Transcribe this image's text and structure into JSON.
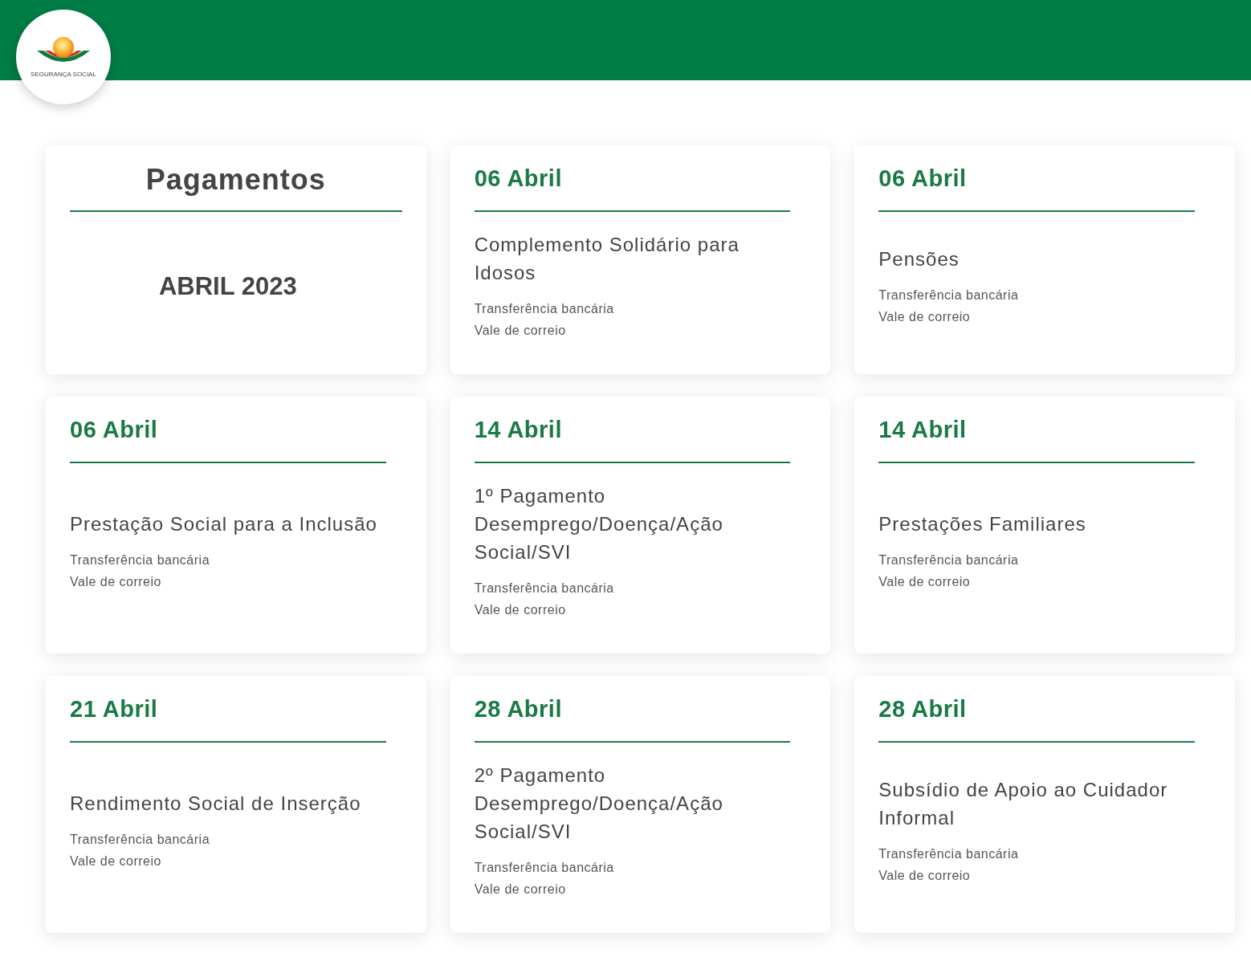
{
  "header": {
    "logo_text": "SEGURANÇA SOCIAL"
  },
  "summary": {
    "title": "Pagamentos",
    "period": "ABRIL 2023"
  },
  "payments": [
    {
      "date": "06 Abril",
      "title": "Complemento Solidário para Idosos",
      "methods": [
        "Transferência bancária",
        "Vale de correio"
      ]
    },
    {
      "date": "06 Abril",
      "title": "Pensões",
      "methods": [
        "Transferência bancária",
        "Vale de correio"
      ]
    },
    {
      "date": "06 Abril",
      "title": "Prestação Social para a Inclusão",
      "methods": [
        "Transferência bancária",
        "Vale de correio"
      ]
    },
    {
      "date": "14 Abril",
      "title": "1º Pagamento Desemprego/Doença/Ação Social/SVI",
      "methods": [
        "Transferência bancária",
        "Vale de correio"
      ]
    },
    {
      "date": "14 Abril",
      "title": "Prestações Familiares",
      "methods": [
        "Transferência bancária",
        "Vale de correio"
      ]
    },
    {
      "date": "21 Abril",
      "title": "Rendimento Social de Inserção",
      "methods": [
        "Transferência bancária",
        "Vale de correio"
      ]
    },
    {
      "date": "28 Abril",
      "title": "2º Pagamento Desemprego/Doença/Ação Social/SVI",
      "methods": [
        "Transferência bancária",
        "Vale de correio"
      ]
    },
    {
      "date": "28 Abril",
      "title": "Subsídio de Apoio ao Cuidador Informal",
      "methods": [
        "Transferência bancária",
        "Vale de correio"
      ]
    }
  ]
}
